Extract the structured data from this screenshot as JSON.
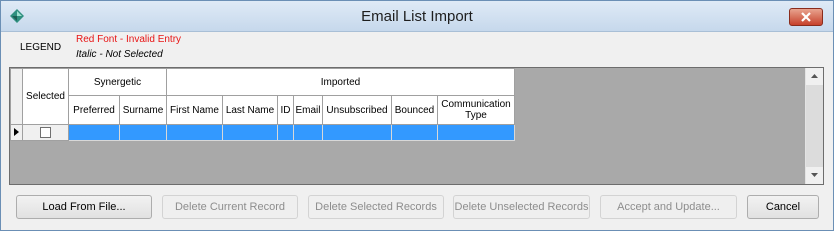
{
  "window": {
    "title": "Email List Import"
  },
  "legend": {
    "label": "LEGEND",
    "red_text": "Red Font - Invalid Entry",
    "italic_text": "Italic - Not Selected"
  },
  "grid": {
    "groups": {
      "selected": "Selected",
      "synergetic": "Synergetic",
      "imported": "Imported"
    },
    "columns": {
      "preferred": "Preferred",
      "surname": "Surname",
      "first_name": "First Name",
      "last_name": "Last Name",
      "id": "ID",
      "email": "Email",
      "unsubscribed": "Unsubscribed",
      "bounced": "Bounced",
      "communication_type": "Communication Type"
    },
    "rows": [
      {
        "selected": false,
        "preferred": "",
        "surname": "",
        "first_name": "",
        "last_name": "",
        "id": "",
        "email": "",
        "unsubscribed": "",
        "bounced": "",
        "communication_type": ""
      }
    ]
  },
  "buttons": {
    "load": "Load From File...",
    "delete_current": "Delete Current Record",
    "delete_selected": "Delete Selected Records",
    "delete_unselected": "Delete Unselected Records",
    "accept": "Accept and Update...",
    "cancel": "Cancel"
  },
  "colors": {
    "selection": "#3399ff",
    "invalid": "#e81515",
    "close": "#c7412b"
  }
}
